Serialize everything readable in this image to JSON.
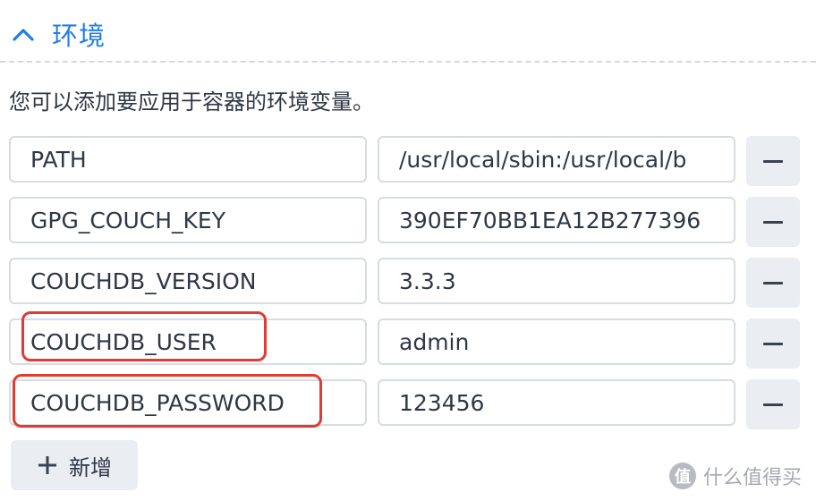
{
  "section": {
    "title": "环境",
    "chevron_icon": "chevron-up-icon",
    "accent_color": "#1f7ee8"
  },
  "description": "您可以添加要应用于容器的环境变量。",
  "env_vars": [
    {
      "key": "PATH",
      "value": "/usr/local/sbin:/usr/local/b"
    },
    {
      "key": "GPG_COUCH_KEY",
      "value": "390EF70BB1EA12B277396"
    },
    {
      "key": "COUCHDB_VERSION",
      "value": "3.3.3"
    },
    {
      "key": "COUCHDB_USER",
      "value": "admin"
    },
    {
      "key": "COUCHDB_PASSWORD",
      "value": "123456"
    }
  ],
  "remove_icon": "minus-icon",
  "add_button": {
    "icon": "plus-icon",
    "label": "新增"
  },
  "highlight_color": "#e23b2f",
  "watermark": {
    "logo_text": "值",
    "text": "什么值得买"
  }
}
